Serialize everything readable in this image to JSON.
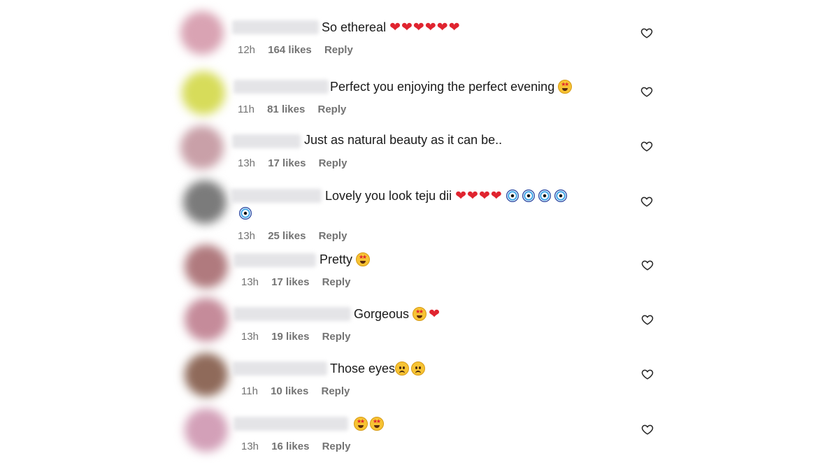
{
  "comments": [
    {
      "text": "So ethereal",
      "emoji": "hearts6",
      "time": "12h",
      "likes": "164 likes",
      "reply": "Reply"
    },
    {
      "text": "Perfect you enjoying the perfect evening",
      "emoji": "starry1",
      "time": "11h",
      "likes": "81 likes",
      "reply": "Reply"
    },
    {
      "text": "Just as natural beauty as it can be..",
      "emoji": "",
      "time": "13h",
      "likes": "17 likes",
      "reply": "Reply"
    },
    {
      "text": "Lovely you look teju dii",
      "emoji": "hearts4-eyes5",
      "time": "13h",
      "likes": "25 likes",
      "reply": "Reply"
    },
    {
      "text": "Pretty",
      "emoji": "starry1",
      "time": "13h",
      "likes": "17 likes",
      "reply": "Reply"
    },
    {
      "text": "Gorgeous",
      "emoji": "starry1-heart1",
      "time": "13h",
      "likes": "19 likes",
      "reply": "Reply"
    },
    {
      "text": "Those eyes",
      "emoji": "sad2",
      "time": "11h",
      "likes": "10 likes",
      "reply": "Reply"
    },
    {
      "text": "",
      "emoji": "starry2",
      "time": "13h",
      "likes": "16 likes",
      "reply": "Reply"
    }
  ],
  "colors": {
    "text": "#1a1a1a",
    "meta": "#737373",
    "heart_emoji": "#e0242f",
    "avatar_tones": [
      "#d9a3b3",
      "#d7dc5a",
      "#c9a0a8",
      "#7b7b7b",
      "#b07a7e",
      "#c58b9a",
      "#8f6a5a",
      "#d3a0b8"
    ]
  },
  "icons": {
    "like": "heart-outline-icon",
    "reaction_heart": "red-heart-emoji",
    "reaction_evil_eye": "nazar-amulet-emoji",
    "reaction_starry": "star-struck-emoji",
    "reaction_sad": "frowning-face-emoji"
  }
}
